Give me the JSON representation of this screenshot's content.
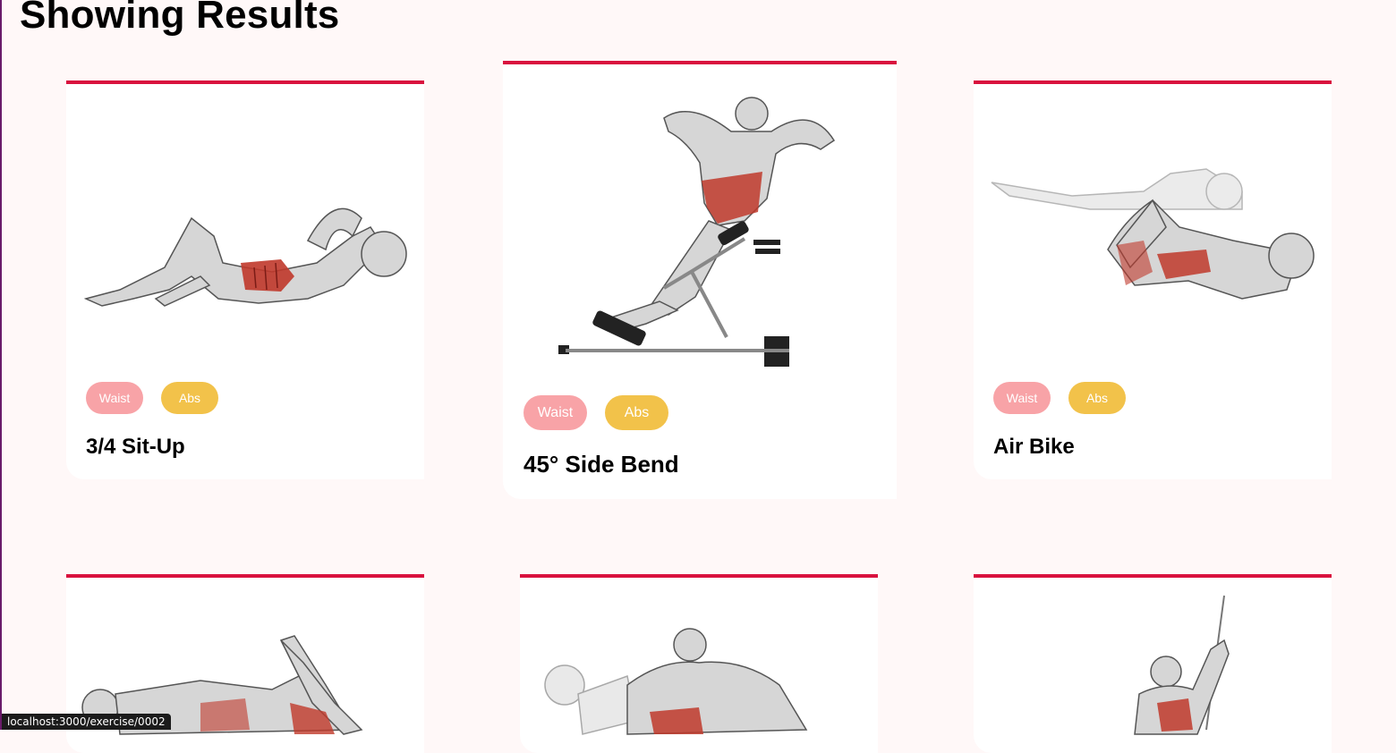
{
  "page_title": "Showing Results",
  "colors": {
    "accent": "#d9123e",
    "tag_body_part": "#f8a3a7",
    "tag_target": "#f2c24a",
    "background": "#fff8f8",
    "card": "#ffffff"
  },
  "cards": [
    {
      "name": "3/4 Sit-Up",
      "body_part": "Waist",
      "target": "Abs",
      "illustration": "sit-up-illustration"
    },
    {
      "name": "45° Side Bend",
      "body_part": "Waist",
      "target": "Abs",
      "illustration": "side-bend-illustration"
    },
    {
      "name": "Air Bike",
      "body_part": "Waist",
      "target": "Abs",
      "illustration": "air-bike-illustration"
    },
    {
      "illustration": "leg-raise-illustration"
    },
    {
      "illustration": "crunch-illustration"
    },
    {
      "illustration": "cable-exercise-illustration"
    }
  ],
  "status_bar": {
    "url": "localhost:3000/exercise/0002"
  }
}
